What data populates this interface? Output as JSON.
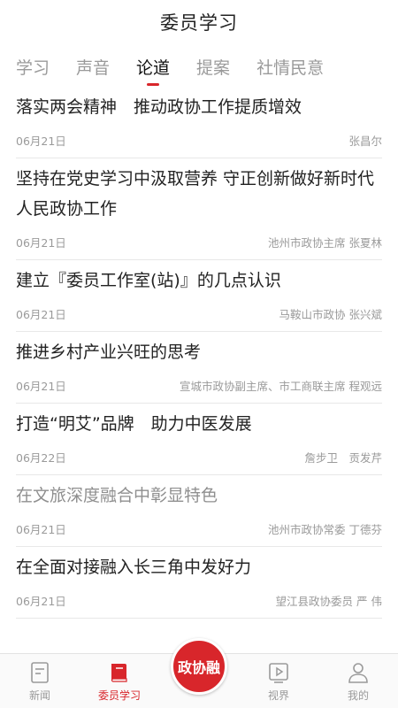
{
  "header": {
    "title": "委员学习"
  },
  "tabs": [
    {
      "label": "学习"
    },
    {
      "label": "声音"
    },
    {
      "label": "论道"
    },
    {
      "label": "提案"
    },
    {
      "label": "社情民意"
    }
  ],
  "articles": [
    {
      "title": "落实两会精神　推动政协工作提质增效",
      "date": "06月21日",
      "author": "张昌尔"
    },
    {
      "title": "坚持在党史学习中汲取营养 守正创新做好新时代人民政协工作",
      "date": "06月21日",
      "author": "池州市政协主席 张夏林"
    },
    {
      "title": "建立『委员工作室(站)』的几点认识",
      "date": "06月21日",
      "author": "马鞍山市政协 张兴斌"
    },
    {
      "title": "推进乡村产业兴旺的思考",
      "date": "06月21日",
      "author": "宣城市政协副主席、市工商联主席 程观远"
    },
    {
      "title": "打造“明艾”品牌　助力中医发展",
      "date": "06月22日",
      "author": "詹步卫　贡发芹"
    },
    {
      "title": "在文旅深度融合中彰显特色",
      "date": "06月21日",
      "author": "池州市政协常委 丁德芬"
    },
    {
      "title": "在全面对接融入长三角中发好力",
      "date": "06月21日",
      "author": "望江县政协委员 严 伟"
    }
  ],
  "tabbar": {
    "news": "新闻",
    "study": "委员学习",
    "center": "政协融",
    "vision": "视界",
    "mine": "我的"
  },
  "colors": {
    "accent": "#d8262b",
    "text": "#222222",
    "muted": "#9a9a9a"
  }
}
